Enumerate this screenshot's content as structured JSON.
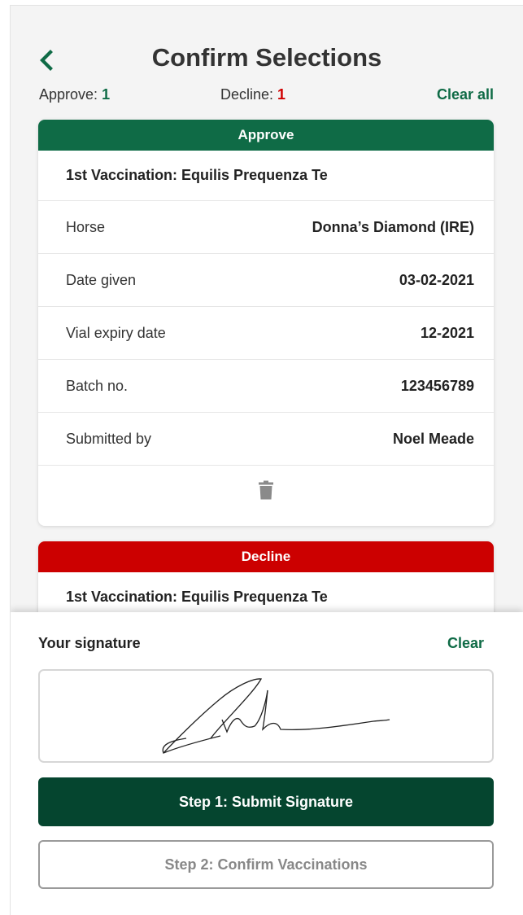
{
  "header": {
    "title": "Confirm Selections",
    "back_icon": "chevron-left-icon"
  },
  "summary": {
    "approve_label": "Approve:",
    "approve_count": "1",
    "decline_label": "Decline:",
    "decline_count": "1",
    "clear_all": "Clear all"
  },
  "approve_card": {
    "status": "Approve",
    "title": "1st Vaccination: Equilis Prequenza Te",
    "rows": [
      {
        "label": "Horse",
        "value": "Donna’s Diamond (IRE)"
      },
      {
        "label": "Date given",
        "value": "03-02-2021"
      },
      {
        "label": "Vial expiry date",
        "value": "12-2021"
      },
      {
        "label": "Batch no.",
        "value": "123456789"
      },
      {
        "label": "Submitted by",
        "value": "Noel Meade"
      }
    ],
    "delete_icon": "trash-icon"
  },
  "decline_card": {
    "status": "Decline",
    "title": "1st Vaccination: Equilis Prequenza Te"
  },
  "signature": {
    "label": "Your signature",
    "clear": "Clear"
  },
  "actions": {
    "submit_signature": "Step 1: Submit Signature",
    "confirm_vaccinations": "Step 2: Confirm Vaccinations"
  },
  "colors": {
    "brand_green": "#0f6b46",
    "dark_green": "#05452f",
    "decline_red": "#cc0000"
  }
}
